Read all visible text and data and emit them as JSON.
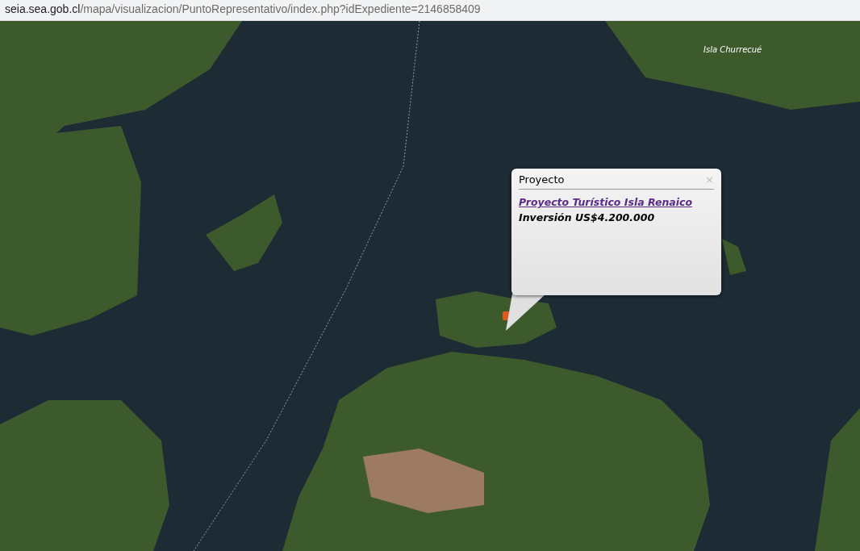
{
  "address_bar": {
    "host": "seia.sea.gob.cl",
    "path": "/mapa/visualizacion/PuntoRepresentativo/index.php?idExpediente=2146858409"
  },
  "map": {
    "labels": [
      "Isla Churrecué"
    ],
    "popup": {
      "title": "Proyecto",
      "close": "×",
      "link": "Proyecto Turístico Isla Renaico",
      "investment": "Inversión US$4.200.000"
    }
  }
}
